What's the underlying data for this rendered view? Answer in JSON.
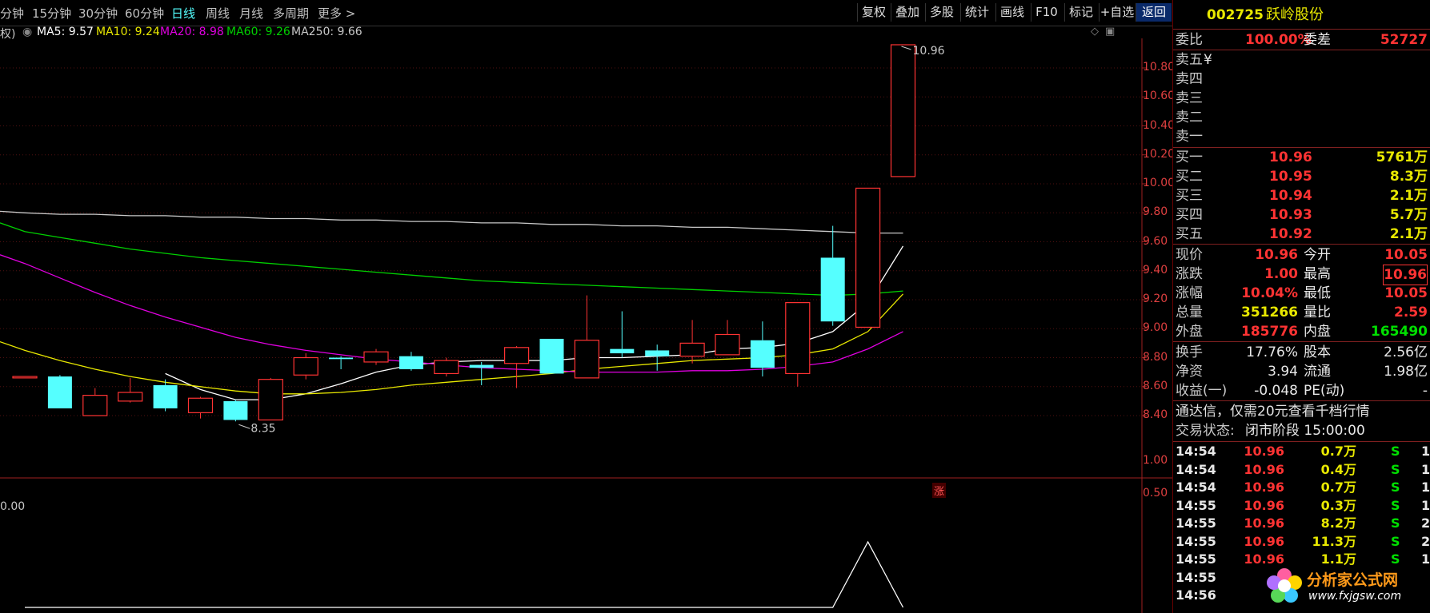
{
  "toolbar": {
    "tabs": [
      "分钟",
      "15分钟",
      "30分钟",
      "60分钟",
      "日线",
      "周线",
      "月线",
      "多周期",
      "更多 >"
    ],
    "right_buttons": [
      "复权",
      "叠加",
      "多股",
      "统计",
      "画线",
      "F10",
      "标记",
      "+自选",
      "返回"
    ]
  },
  "indicator_line": {
    "prefix": "权)",
    "ma5": "MA5: 9.57",
    "ma10": "MA10: 9.24",
    "ma20": "MA20: 8.98",
    "ma60": "MA60: 9.26",
    "ma250": "MA250: 9.66"
  },
  "colors": {
    "ma5": "#ffffff",
    "ma10": "#e8e800",
    "ma20": "#e000e0",
    "ma60": "#00d000",
    "ma250": "#c8c8c8",
    "up": "#ff3333",
    "down": "#55ffff",
    "axis": "#e04040"
  },
  "chart_data": {
    "type": "candlestick",
    "y_axis_labels": [
      "10.80",
      "10.60",
      "10.40",
      "10.20",
      "10.00",
      "9.80",
      "9.60",
      "9.40",
      "9.20",
      "9.00",
      "8.80",
      "8.60",
      "8.40"
    ],
    "ylim": [
      8.3,
      11.0
    ],
    "high_label": "10.96",
    "low_label": "8.35",
    "limit_up_marker": "涨",
    "candles": [
      {
        "o": 8.66,
        "c": 8.67,
        "h": 8.67,
        "l": 8.66
      },
      {
        "o": 8.67,
        "c": 8.45,
        "h": 8.68,
        "l": 8.45
      },
      {
        "o": 8.4,
        "c": 8.54,
        "h": 8.59,
        "l": 8.4
      },
      {
        "o": 8.5,
        "c": 8.56,
        "h": 8.66,
        "l": 8.49
      },
      {
        "o": 8.61,
        "c": 8.45,
        "h": 8.65,
        "l": 8.43
      },
      {
        "o": 8.42,
        "c": 8.52,
        "h": 8.53,
        "l": 8.38
      },
      {
        "o": 8.5,
        "c": 8.37,
        "h": 8.51,
        "l": 8.36
      },
      {
        "o": 8.37,
        "c": 8.65,
        "h": 8.66,
        "l": 8.37
      },
      {
        "o": 8.68,
        "c": 8.8,
        "h": 8.83,
        "l": 8.65
      },
      {
        "o": 8.8,
        "c": 8.79,
        "h": 8.81,
        "l": 8.72
      },
      {
        "o": 8.77,
        "c": 8.84,
        "h": 8.86,
        "l": 8.75
      },
      {
        "o": 8.81,
        "c": 8.72,
        "h": 8.84,
        "l": 8.71
      },
      {
        "o": 8.69,
        "c": 8.78,
        "h": 8.8,
        "l": 8.67
      },
      {
        "o": 8.75,
        "c": 8.73,
        "h": 8.77,
        "l": 8.61
      },
      {
        "o": 8.76,
        "c": 8.87,
        "h": 8.88,
        "l": 8.59
      },
      {
        "o": 8.93,
        "c": 8.69,
        "h": 8.93,
        "l": 8.69
      },
      {
        "o": 8.66,
        "c": 8.92,
        "h": 9.23,
        "l": 8.66
      },
      {
        "o": 8.86,
        "c": 8.83,
        "h": 9.12,
        "l": 8.8
      },
      {
        "o": 8.85,
        "c": 8.81,
        "h": 8.89,
        "l": 8.71
      },
      {
        "o": 8.81,
        "c": 8.9,
        "h": 9.06,
        "l": 8.76
      },
      {
        "o": 8.82,
        "c": 8.96,
        "h": 9.06,
        "l": 8.82
      },
      {
        "o": 8.92,
        "c": 8.73,
        "h": 9.05,
        "l": 8.67
      },
      {
        "o": 8.69,
        "c": 9.18,
        "h": 9.18,
        "l": 8.6
      },
      {
        "o": 9.49,
        "c": 9.05,
        "h": 9.71,
        "l": 9.02
      },
      {
        "o": 9.01,
        "c": 9.97,
        "h": 9.97,
        "l": 9.01
      },
      {
        "o": 10.05,
        "c": 10.96,
        "h": 10.96,
        "l": 10.05
      }
    ],
    "ma_series": [
      {
        "name": "MA5",
        "values": [
          null,
          null,
          null,
          null,
          8.69,
          8.58,
          8.51,
          8.51,
          8.55,
          8.62,
          8.7,
          8.75,
          8.77,
          8.78,
          8.78,
          8.78,
          8.8,
          8.8,
          8.81,
          8.82,
          8.86,
          8.87,
          8.9,
          8.98,
          9.18,
          9.57
        ]
      },
      {
        "name": "MA10",
        "values": [
          8.85,
          8.78,
          8.72,
          8.67,
          8.63,
          8.6,
          8.57,
          8.55,
          8.55,
          8.56,
          8.58,
          8.61,
          8.63,
          8.65,
          8.67,
          8.69,
          8.72,
          8.74,
          8.76,
          8.78,
          8.79,
          8.8,
          8.82,
          8.86,
          8.98,
          9.24
        ]
      },
      {
        "name": "MA20",
        "values": [
          9.45,
          9.35,
          9.25,
          9.16,
          9.08,
          9.01,
          8.94,
          8.89,
          8.85,
          8.82,
          8.79,
          8.77,
          8.75,
          8.73,
          8.72,
          8.71,
          8.7,
          8.7,
          8.7,
          8.71,
          8.71,
          8.72,
          8.74,
          8.77,
          8.86,
          8.98
        ]
      },
      {
        "name": "MA60",
        "values": [
          9.67,
          9.63,
          9.59,
          9.55,
          9.52,
          9.49,
          9.47,
          9.45,
          9.43,
          9.41,
          9.39,
          9.37,
          9.35,
          9.33,
          9.32,
          9.31,
          9.3,
          9.29,
          9.28,
          9.27,
          9.26,
          9.25,
          9.24,
          9.23,
          9.24,
          9.26
        ]
      },
      {
        "name": "MA250",
        "values": [
          9.8,
          9.79,
          9.79,
          9.78,
          9.78,
          9.77,
          9.77,
          9.76,
          9.76,
          9.75,
          9.75,
          9.74,
          9.74,
          9.73,
          9.73,
          9.72,
          9.72,
          9.71,
          9.71,
          9.7,
          9.7,
          9.69,
          9.68,
          9.67,
          9.66,
          9.66
        ]
      }
    ],
    "sub": {
      "label": "0.00",
      "axis_labels": [
        "1.00",
        "0.50"
      ],
      "values": [
        0,
        0,
        0,
        0,
        0,
        0,
        0,
        0,
        0,
        0,
        0,
        0,
        0,
        0,
        0,
        0,
        0,
        0,
        0,
        0,
        0,
        0,
        0,
        0,
        1,
        0
      ]
    }
  },
  "panel": {
    "code": "002725",
    "name": "跃岭股份",
    "weibi_label": "委比",
    "weibi_value": "100.00%",
    "weicha_label": "委差",
    "weicha_value": "52727",
    "sells": [
      {
        "label": "卖五",
        "price": "¥",
        "vol": ""
      },
      {
        "label": "卖四",
        "price": "",
        "vol": ""
      },
      {
        "label": "卖三",
        "price": "",
        "vol": ""
      },
      {
        "label": "卖二",
        "price": "",
        "vol": ""
      },
      {
        "label": "卖一",
        "price": "",
        "vol": ""
      }
    ],
    "buys": [
      {
        "label": "买一",
        "price": "10.96",
        "vol": "5761万"
      },
      {
        "label": "买二",
        "price": "10.95",
        "vol": "8.3万"
      },
      {
        "label": "买三",
        "price": "10.94",
        "vol": "2.1万"
      },
      {
        "label": "买四",
        "price": "10.93",
        "vol": "5.7万"
      },
      {
        "label": "买五",
        "price": "10.92",
        "vol": "2.1万"
      }
    ],
    "stats": [
      {
        "l1": "现价",
        "v1": "10.96",
        "c1": "red",
        "l2": "今开",
        "v2": "10.05",
        "c2": "red"
      },
      {
        "l1": "涨跌",
        "v1": "1.00",
        "c1": "red",
        "l2": "最高",
        "v2": "10.96",
        "c2": "red"
      },
      {
        "l1": "涨幅",
        "v1": "10.04%",
        "c1": "red",
        "l2": "最低",
        "v2": "10.05",
        "c2": "red"
      },
      {
        "l1": "总量",
        "v1": "351266",
        "c1": "yel",
        "l2": "量比",
        "v2": "2.59",
        "c2": "red"
      },
      {
        "l1": "外盘",
        "v1": "185776",
        "c1": "red",
        "l2": "内盘",
        "v2": "165490",
        "c2": "grn"
      }
    ],
    "stats2": [
      {
        "l1": "换手",
        "v1": "17.76%",
        "l2": "股本",
        "v2": "2.56亿"
      },
      {
        "l1": "净资",
        "v1": "3.94",
        "l2": "流通",
        "v2": "1.98亿"
      },
      {
        "l1": "收益(一)",
        "v1": "-0.048",
        "l2": "PE(动)",
        "v2": "-"
      }
    ],
    "promo": "通达信，仅需20元查看千档行情",
    "trade_status_label": "交易状态:",
    "trade_status_value": "闭市阶段 15:00:00",
    "ticks": [
      {
        "time": "14:54",
        "price": "10.96",
        "vol": "0.7万",
        "side": "S",
        "n": "1"
      },
      {
        "time": "14:54",
        "price": "10.96",
        "vol": "0.4万",
        "side": "S",
        "n": "1"
      },
      {
        "time": "14:54",
        "price": "10.96",
        "vol": "0.7万",
        "side": "S",
        "n": "1"
      },
      {
        "time": "14:55",
        "price": "10.96",
        "vol": "0.3万",
        "side": "S",
        "n": "1"
      },
      {
        "time": "14:55",
        "price": "10.96",
        "vol": "8.2万",
        "side": "S",
        "n": "2"
      },
      {
        "time": "14:55",
        "price": "10.96",
        "vol": "11.3万",
        "side": "S",
        "n": "2"
      },
      {
        "time": "14:55",
        "price": "10.96",
        "vol": "1.1万",
        "side": "S",
        "n": "1"
      },
      {
        "time": "14:55",
        "price": "",
        "vol": "",
        "side": "",
        "n": ""
      },
      {
        "time": "14:56",
        "price": "",
        "vol": "",
        "side": "",
        "n": ""
      }
    ],
    "watermark_title": "分析家公式网",
    "watermark_url": "www.fxjgsw.com"
  }
}
